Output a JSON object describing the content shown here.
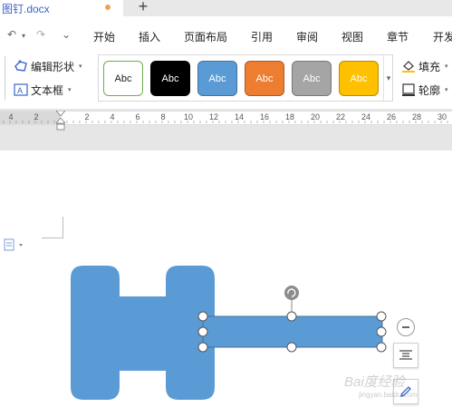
{
  "tab": {
    "title": "图钉.docx",
    "new_tab": "+"
  },
  "quick_access": {
    "undo": "↶",
    "redo": "↷",
    "customize": "⌄"
  },
  "menu": {
    "items": [
      "开始",
      "插入",
      "页面布局",
      "引用",
      "审阅",
      "视图",
      "章节",
      "开发"
    ]
  },
  "ribbon": {
    "edit_shape": "编辑形状",
    "text_box": "文本框",
    "fill": "填充",
    "outline": "轮廓",
    "styles": [
      {
        "label": "Abc",
        "bg": "#ffffff",
        "border": "#70ad47",
        "color": "#222222"
      },
      {
        "label": "Abc",
        "bg": "#000000",
        "border": "#000000",
        "color": "#ffffff"
      },
      {
        "label": "Abc",
        "bg": "#5b9bd5",
        "border": "#41719c",
        "color": "#ffffff"
      },
      {
        "label": "Abc",
        "bg": "#ed7d31",
        "border": "#ae5a21",
        "color": "#ffffff"
      },
      {
        "label": "Abc",
        "bg": "#a5a5a5",
        "border": "#787878",
        "color": "#ffffff"
      },
      {
        "label": "Abc",
        "bg": "#ffc000",
        "border": "#bc8c00",
        "color": "#ffffff"
      }
    ]
  },
  "ruler": {
    "labels": [
      "4",
      "2",
      "2",
      "4",
      "6",
      "8",
      "10",
      "12",
      "14",
      "16",
      "18",
      "20",
      "22",
      "24",
      "26",
      "28",
      "30"
    ]
  },
  "watermark": {
    "main": "Bai度经验",
    "sub": "jingyan.baidu.com"
  },
  "colors": {
    "shape_fill": "#5b9bd5",
    "handle": "#ffffff",
    "title_blue": "#3a64c8"
  }
}
